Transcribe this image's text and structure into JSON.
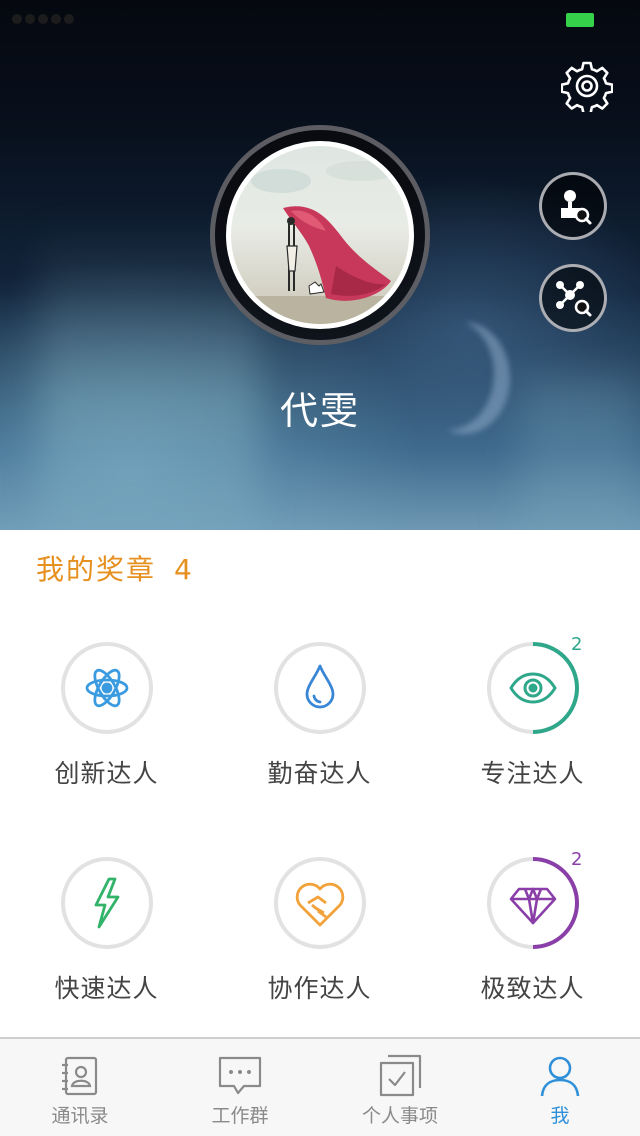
{
  "profile": {
    "name": "代雯"
  },
  "medals": {
    "title": "我的奖章",
    "count": "4",
    "items": [
      {
        "label": "创新达人",
        "color": "#3a9be0",
        "icon": "atom-icon",
        "progress": 0,
        "count": ""
      },
      {
        "label": "勤奋达人",
        "color": "#3a86d6",
        "icon": "water-drop-icon",
        "progress": 0,
        "count": ""
      },
      {
        "label": "专注达人",
        "color": "#2fa78a",
        "icon": "eye-icon",
        "progress": 0.5,
        "count": "2"
      },
      {
        "label": "快速达人",
        "color": "#31b36a",
        "icon": "lightning-icon",
        "progress": 0,
        "count": ""
      },
      {
        "label": "协作达人",
        "color": "#f2a23a",
        "icon": "handshake-heart-icon",
        "progress": 0,
        "count": ""
      },
      {
        "label": "极致达人",
        "color": "#8a3fa8",
        "icon": "diamond-icon",
        "progress": 0.5,
        "count": "2"
      }
    ]
  },
  "tabs": [
    {
      "label": "通讯录",
      "icon": "contacts-book-icon"
    },
    {
      "label": "工作群",
      "icon": "chat-bubble-icon"
    },
    {
      "label": "个人事项",
      "icon": "checklist-icon"
    },
    {
      "label": "我",
      "icon": "person-icon",
      "active": true
    }
  ],
  "colors": {
    "accent": "#e6901f",
    "active_tab": "#2f8fd8",
    "battery": "#35d14b"
  }
}
